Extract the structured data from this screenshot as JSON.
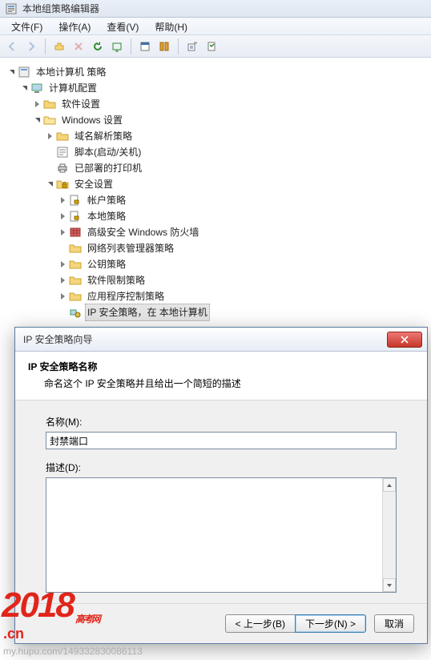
{
  "window": {
    "title": "本地组策略编辑器"
  },
  "menu": {
    "file": "文件(F)",
    "action": "操作(A)",
    "view": "查看(V)",
    "help": "帮助(H)"
  },
  "tree": {
    "root": "本地计算机 策略",
    "computerConfig": "计算机配置",
    "softwareSettings": "软件设置",
    "windowsSettings": "Windows 设置",
    "nameResPolicy": "域名解析策略",
    "scripts": "脚本(启动/关机)",
    "deployedPrinters": "已部署的打印机",
    "securitySettings": "安全设置",
    "accountPolicies": "帐户策略",
    "localPolicies": "本地策略",
    "wfas": "高级安全 Windows 防火墙",
    "nlmPolicies": "网络列表管理器策略",
    "publicKey": "公钥策略",
    "softwareRestriction": "软件限制策略",
    "appControl": "应用程序控制策略",
    "ipsec": "IP 安全策略，在 本地计算机"
  },
  "dialog": {
    "title": "IP 安全策略向导",
    "header": "IP 安全策略名称",
    "subheader": "命名这个 IP 安全策略并且给出一个简短的描述",
    "nameLabel": "名称(M):",
    "nameValue": "封禁端口",
    "descLabel": "描述(D):",
    "descValue": "",
    "back": "< 上一步(B)",
    "next": "下一步(N) >",
    "cancel": "取消"
  },
  "watermark": {
    "year": "2018",
    "suffix": "高考网",
    "cn": ".cn",
    "url": "my.hupu.com/149332830086113"
  }
}
